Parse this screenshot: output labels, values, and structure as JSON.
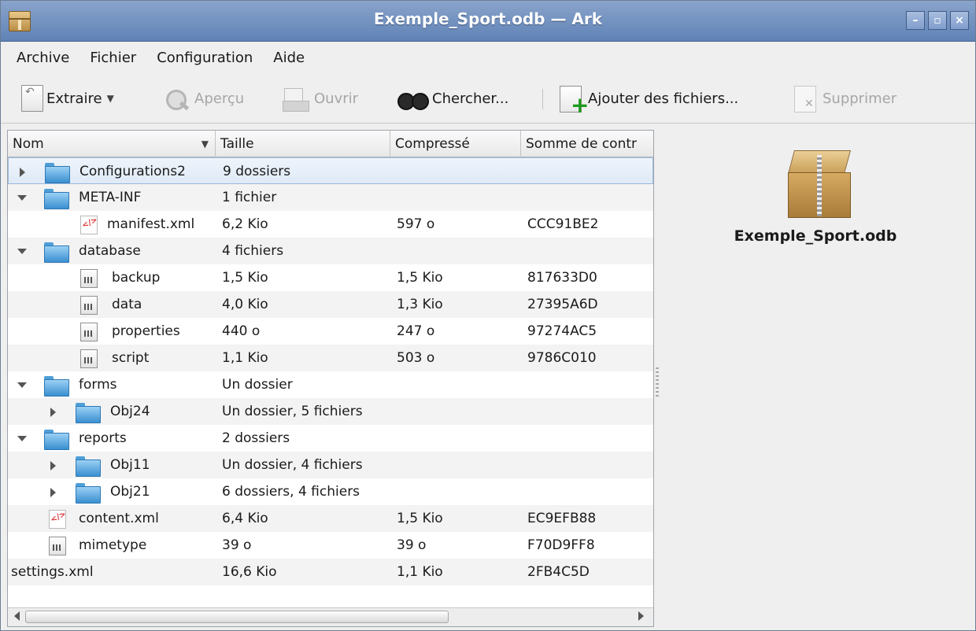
{
  "window": {
    "title": "Exemple_Sport.odb — Ark"
  },
  "menu": [
    "Archive",
    "Fichier",
    "Configuration",
    "Aide"
  ],
  "toolbar": {
    "extract": "Extraire",
    "preview": "Aperçu",
    "open": "Ouvrir",
    "find": "Chercher...",
    "add": "Ajouter des fichiers...",
    "delete": "Supprimer"
  },
  "columns": [
    "Nom",
    "Taille",
    "Compressé",
    "Somme de contr"
  ],
  "rows": [
    {
      "name": "Configurations2",
      "size": "9 dossiers",
      "compressed": "",
      "checksum": ""
    },
    {
      "name": "META-INF",
      "size": "1 fichier",
      "compressed": "",
      "checksum": ""
    },
    {
      "name": "manifest.xml",
      "size": "6,2 Kio",
      "compressed": "597 o",
      "checksum": "CCC91BE2"
    },
    {
      "name": "database",
      "size": "4 fichiers",
      "compressed": "",
      "checksum": ""
    },
    {
      "name": "backup",
      "size": "1,5 Kio",
      "compressed": "1,5 Kio",
      "checksum": "817633D0"
    },
    {
      "name": "data",
      "size": "4,0 Kio",
      "compressed": "1,3 Kio",
      "checksum": "27395A6D"
    },
    {
      "name": "properties",
      "size": "440 o",
      "compressed": "247 o",
      "checksum": "97274AC5"
    },
    {
      "name": "script",
      "size": "1,1 Kio",
      "compressed": "503 o",
      "checksum": "9786C010"
    },
    {
      "name": "forms",
      "size": "Un dossier",
      "compressed": "",
      "checksum": ""
    },
    {
      "name": "Obj24",
      "size": "Un dossier, 5 fichiers",
      "compressed": "",
      "checksum": ""
    },
    {
      "name": "reports",
      "size": "2 dossiers",
      "compressed": "",
      "checksum": ""
    },
    {
      "name": "Obj11",
      "size": "Un dossier, 4 fichiers",
      "compressed": "",
      "checksum": ""
    },
    {
      "name": "Obj21",
      "size": "6 dossiers, 4 fichiers",
      "compressed": "",
      "checksum": ""
    },
    {
      "name": "content.xml",
      "size": "6,4 Kio",
      "compressed": "1,5 Kio",
      "checksum": "EC9EFB88"
    },
    {
      "name": "mimetype",
      "size": "39 o",
      "compressed": "39 o",
      "checksum": "F70D9FF8"
    },
    {
      "name": "settings.xml",
      "size": "16,6 Kio",
      "compressed": "1,1 Kio",
      "checksum": "2FB4C5D"
    }
  ],
  "info": {
    "filename": "Exemple_Sport.odb"
  }
}
